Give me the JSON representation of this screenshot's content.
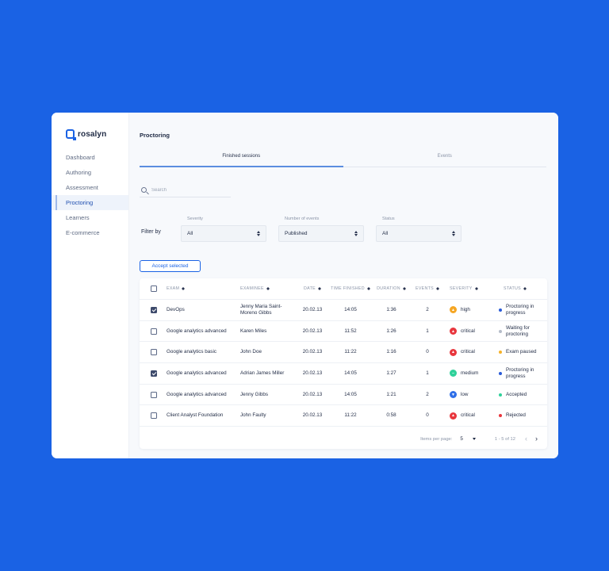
{
  "app": {
    "name": "rosalyn"
  },
  "sidebar": {
    "items": [
      {
        "label": "Dashboard"
      },
      {
        "label": "Authoring"
      },
      {
        "label": "Assessment"
      },
      {
        "label": "Proctoring"
      },
      {
        "label": "Learners"
      },
      {
        "label": "E-commerce"
      }
    ]
  },
  "page": {
    "title": "Proctoring"
  },
  "tabs": [
    {
      "label": "Finished sessions"
    },
    {
      "label": "Events"
    }
  ],
  "search": {
    "placeholder": "Search"
  },
  "filters": {
    "label": "Filter by",
    "severity": {
      "caption": "Severity",
      "value": "All"
    },
    "events": {
      "caption": "Number of events",
      "value": "Published"
    },
    "status": {
      "caption": "Status",
      "value": "All"
    }
  },
  "actions": {
    "accept_label": "Accept selected"
  },
  "table": {
    "headers": {
      "exam": "EXAM",
      "examinee": "EXAMINEE",
      "date": "DATE",
      "time": "TIME FINISHED",
      "duration": "DURATION",
      "events": "EVENTS",
      "severity": "SEVERITY",
      "status": "STATUS"
    },
    "rows": [
      {
        "exam": "DevOps",
        "examinee": "Jenny Maria Saint-Moreno Gibbs",
        "date": "20.02.13",
        "time": "14:05",
        "duration": "1:36",
        "events": "2",
        "severity": "high",
        "status": "Proctoring in progress"
      },
      {
        "exam": "Google analytics advanced",
        "examinee": "Karen Miles",
        "date": "20.02.13",
        "time": "11:52",
        "duration": "1:26",
        "events": "1",
        "severity": "critical",
        "status": "Waiting for proctoring"
      },
      {
        "exam": "Google analytics basic",
        "examinee": "John Doe",
        "date": "20.02.13",
        "time": "11:22",
        "duration": "1:16",
        "events": "0",
        "severity": "critical",
        "status": "Exam paused"
      },
      {
        "exam": "Google analytics advanced",
        "examinee": "Adrian James Miller",
        "date": "20.02.13",
        "time": "14:05",
        "duration": "1:27",
        "events": "1",
        "severity": "medium",
        "status": "Proctoring in progress"
      },
      {
        "exam": "Google analytics advanced",
        "examinee": "Jenny Gibbs",
        "date": "20.02.13",
        "time": "14:05",
        "duration": "1:21",
        "events": "2",
        "severity": "low",
        "status": "Accepted"
      },
      {
        "exam": "Client Analyst Foundation",
        "examinee": "John Faulty",
        "date": "20.02.13",
        "time": "11:22",
        "duration": "0:58",
        "events": "0",
        "severity": "critical",
        "status": "Rejected"
      }
    ]
  },
  "pagination": {
    "per_page_label": "Items per page:",
    "per_page": "5",
    "range": "1 - 5 of 12"
  },
  "colors": {
    "accent": "#1a62e4",
    "severity_high": "#f5a623",
    "severity_critical": "#e8363d",
    "severity_medium": "#2fd19a",
    "severity_low": "#2f6fe8",
    "status_progress": "#2a5bd7",
    "status_waiting": "#b6bdc9",
    "status_paused": "#f5b229",
    "status_accepted": "#2fd19a",
    "status_rejected": "#e8363d"
  }
}
